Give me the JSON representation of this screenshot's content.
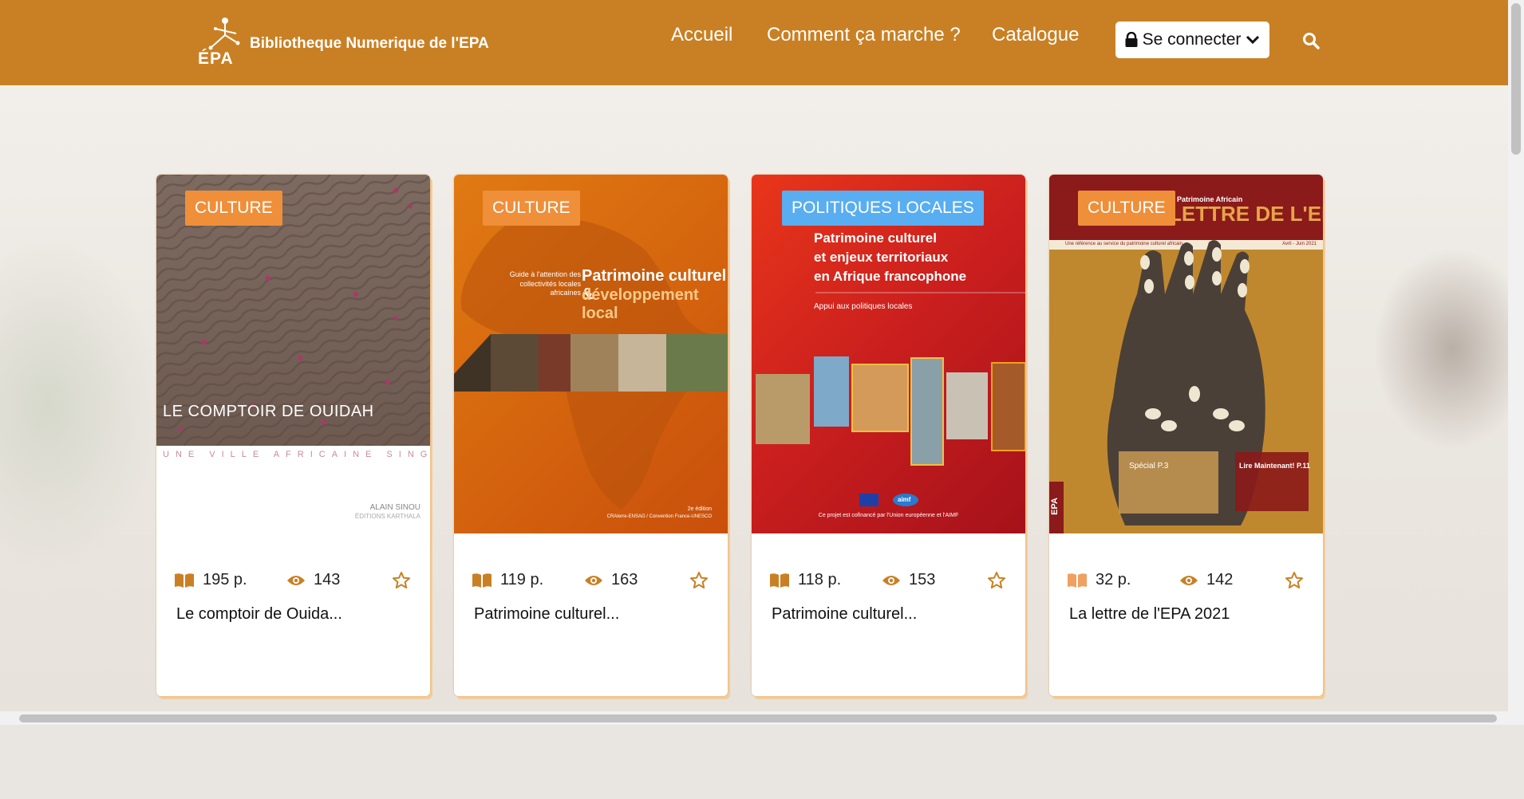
{
  "header": {
    "logo_text": "ÉPA",
    "site_title": "Bibliotheque Numerique de l'EPA",
    "nav": [
      "Accueil",
      "Comment ça marche ?",
      "Catalogue"
    ],
    "login_label": "Se connecter",
    "brand_color": "#c98024"
  },
  "books": [
    {
      "category": "CULTURE",
      "pages": "195 p.",
      "views": "143",
      "title": "Le comptoir de Ouida...",
      "cover": {
        "main": "LE COMPTOIR DE OUIDAH",
        "sub": "UNE VILLE AFRICAINE SINGULIÈRE",
        "author": "ALAIN SINOU",
        "publisher": "ÉDITIONS KARTHALA"
      }
    },
    {
      "category": "CULTURE",
      "pages": "119 p.",
      "views": "163",
      "title": "Patrimoine culturel...",
      "cover": {
        "guide": "Guide à l'attention des collectivités locales africaines",
        "main1": "Patrimoine culturel &",
        "main2": "développement local",
        "edition": "2e édition",
        "partners": "CRAterre-ENSAG / Convention France-UNESCO"
      }
    },
    {
      "category": "POLITIQUES LOCALES",
      "pages": "118 p.",
      "views": "153",
      "title": "Patrimoine culturel...",
      "cover": {
        "main1": "Patrimoine culturel",
        "main2": "et enjeux territoriaux",
        "main3": "en Afrique francophone",
        "sub": "Appui aux politiques locales",
        "footer": "Ce projet est cofinancé par l'Union européenne et l'AIMF",
        "aimf": "aimf"
      }
    },
    {
      "category": "CULTURE",
      "pages": "32 p.",
      "views": "142",
      "title": "La lettre de l'EPA 2021",
      "cover": {
        "top": "Patrimoine Africain",
        "masthead": "LETTRE DE L'EPA",
        "tagline": "Une référence au service du patrimoine culturel africain",
        "date": "Avril - Juin 2021",
        "special": "Spécial P.3",
        "cta": "Lire Maintenant! P.11",
        "side": "EPA"
      }
    }
  ]
}
